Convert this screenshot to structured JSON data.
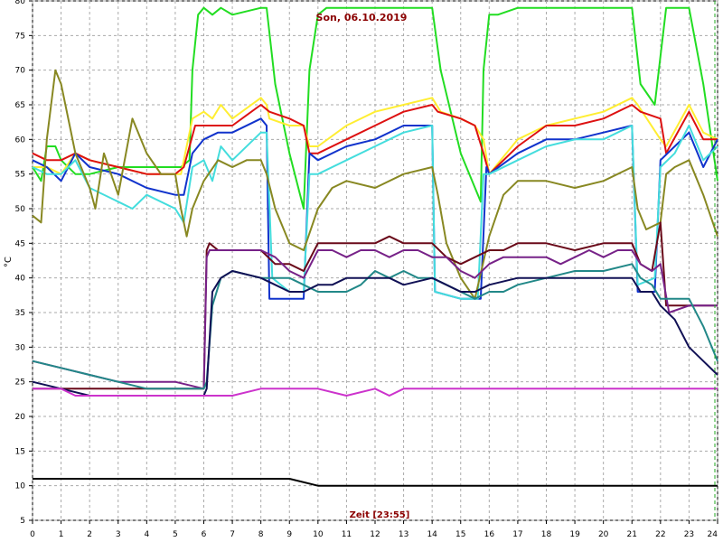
{
  "chart_data": {
    "type": "line",
    "title": "Son, 06.10.2019",
    "xlabel": "Zeit [23:55]",
    "ylabel": "°C",
    "xlim": [
      0,
      24
    ],
    "ylim": [
      5,
      80
    ],
    "xticks": [
      "0",
      "1",
      "2",
      "3",
      "4",
      "5",
      "6",
      "7",
      "8",
      "9",
      "10",
      "11",
      "12",
      "13",
      "14",
      "15",
      "16",
      "17",
      "18",
      "19",
      "20",
      "21",
      "22",
      "23",
      "24"
    ],
    "yticks": [
      "5",
      "10",
      "15",
      "20",
      "25",
      "30",
      "35",
      "40",
      "45",
      "50",
      "55",
      "60",
      "65",
      "70",
      "75",
      "80"
    ],
    "grid": true,
    "series": [
      {
        "color": "#22dd22",
        "x": [
          0,
          0.3,
          0.5,
          0.8,
          1,
          1.5,
          2,
          3,
          4,
          5.2,
          5.5,
          5.6,
          5.8,
          6,
          6.3,
          6.6,
          7,
          8,
          8.2,
          8.5,
          9,
          9.5,
          9.7,
          10,
          10.3,
          11,
          12,
          13,
          14,
          14.3,
          15,
          15.7,
          15.8,
          16,
          16.3,
          17,
          18,
          19,
          20,
          21,
          21.3,
          21.8,
          22,
          22.2,
          22.5,
          23,
          23.5,
          24
        ],
        "y": [
          56,
          54,
          59,
          59,
          57,
          55,
          55,
          56,
          56,
          56,
          57,
          70,
          78,
          79,
          78,
          79,
          78,
          79,
          79,
          68,
          58,
          50,
          70,
          78,
          79,
          79,
          79,
          79,
          79,
          70,
          58,
          51,
          70,
          78,
          78,
          79,
          79,
          79,
          79,
          79,
          68,
          65,
          72,
          79,
          79,
          79,
          68,
          54
        ]
      },
      {
        "color": "#ffee33",
        "x": [
          0,
          0.5,
          1,
          1.5,
          2,
          3,
          4,
          5,
          5.2,
          5.6,
          6,
          6.3,
          6.6,
          7,
          8,
          8.2,
          8.3,
          9,
          9.5,
          9.7,
          10,
          11,
          12,
          13,
          14,
          14.3,
          15,
          15.5,
          15.8,
          16,
          17,
          18,
          19,
          20,
          21,
          21.2,
          22,
          22.2,
          23,
          23.5,
          24
        ],
        "y": [
          56,
          56,
          55,
          58,
          57,
          56,
          55,
          55,
          55,
          63,
          64,
          63,
          65,
          63,
          66,
          65,
          63,
          62,
          62,
          59,
          59,
          62,
          64,
          65,
          66,
          64,
          63,
          62,
          60,
          55,
          60,
          62,
          63,
          64,
          66,
          65,
          60,
          59,
          65,
          61,
          60
        ]
      },
      {
        "color": "#dd1111",
        "x": [
          0,
          0.5,
          1,
          1.5,
          2,
          3,
          4,
          5,
          5.3,
          5.7,
          6,
          6.5,
          7,
          8,
          8.3,
          9,
          9.5,
          9.7,
          10,
          11,
          12,
          13,
          14,
          14.2,
          15,
          15.5,
          15.8,
          16,
          17,
          18,
          19,
          20,
          21,
          21.3,
          22,
          22.2,
          23,
          23.5,
          24
        ],
        "y": [
          58,
          57,
          57,
          58,
          57,
          56,
          55,
          55,
          56,
          62,
          62,
          62,
          62,
          65,
          64,
          63,
          62,
          58,
          58,
          60,
          62,
          64,
          65,
          64,
          63,
          62,
          58,
          55,
          59,
          62,
          62,
          63,
          65,
          64,
          63,
          58,
          64,
          60,
          60
        ]
      },
      {
        "color": "#1133cc",
        "x": [
          0,
          0.5,
          1,
          1.5,
          2,
          3,
          4,
          5,
          5.3,
          5.6,
          6,
          6.5,
          7,
          8,
          8.2,
          8.3,
          8.5,
          9,
          9.5,
          9.7,
          10,
          11,
          12,
          13,
          14,
          14.1,
          15,
          15.7,
          15.9,
          16,
          17,
          18,
          19,
          20,
          21,
          21.2,
          21.8,
          22,
          22.5,
          23,
          23.5,
          24
        ],
        "y": [
          57,
          56,
          54,
          58,
          56,
          55,
          53,
          52,
          52,
          58,
          60,
          61,
          61,
          63,
          62,
          37,
          37,
          37,
          37,
          58,
          57,
          59,
          60,
          62,
          62,
          38,
          37,
          37,
          56,
          55,
          58,
          60,
          60,
          61,
          62,
          38,
          38,
          57,
          59,
          61,
          56,
          60
        ]
      },
      {
        "color": "#44dddd",
        "x": [
          0,
          0.5,
          1,
          1.5,
          2,
          3,
          3.5,
          4,
          5,
          5.3,
          5.6,
          6,
          6.3,
          6.6,
          7,
          8,
          8.2,
          8.4,
          9,
          9.5,
          9.7,
          10,
          11,
          12,
          13,
          14,
          14.1,
          15,
          15.6,
          15.8,
          16,
          17,
          18,
          19,
          20,
          21,
          21.2,
          21.8,
          22,
          22.5,
          23,
          23.5,
          24
        ],
        "y": [
          56,
          55,
          55,
          57,
          53,
          51,
          50,
          52,
          50,
          48,
          56,
          57,
          54,
          59,
          57,
          61,
          61,
          40,
          38,
          38,
          55,
          55,
          57,
          59,
          61,
          62,
          38,
          37,
          37,
          55,
          55,
          57,
          59,
          60,
          60,
          62,
          39,
          40,
          56,
          58,
          62,
          57,
          59
        ]
      },
      {
        "color": "#888822",
        "x": [
          0,
          0.3,
          0.5,
          0.8,
          1,
          1.3,
          1.5,
          2,
          2.2,
          2.5,
          3,
          3.5,
          4,
          4.5,
          5,
          5.2,
          5.4,
          5.6,
          6,
          6.5,
          7,
          7.5,
          8,
          8.2,
          8.5,
          9,
          9.5,
          10,
          10.5,
          11,
          12,
          13,
          14,
          14.2,
          14.5,
          15,
          15.5,
          16,
          16.5,
          17,
          18,
          19,
          20,
          21,
          21.2,
          21.5,
          22,
          22.2,
          22.5,
          23,
          23.5,
          24
        ],
        "y": [
          49,
          48,
          60,
          70,
          68,
          62,
          58,
          53,
          50,
          58,
          52,
          63,
          58,
          55,
          55,
          50,
          46,
          50,
          54,
          57,
          56,
          57,
          57,
          55,
          50,
          45,
          44,
          50,
          53,
          54,
          53,
          55,
          56,
          52,
          45,
          40,
          37,
          46,
          52,
          54,
          54,
          53,
          54,
          56,
          50,
          47,
          48,
          55,
          56,
          57,
          52,
          46
        ]
      },
      {
        "color": "#6a0a1a",
        "x": [
          0,
          6,
          6.1,
          6.2,
          6.5,
          7,
          8,
          8.5,
          9,
          9.5,
          10,
          11,
          12,
          12.5,
          13,
          14,
          14.5,
          15,
          15.5,
          16,
          16.5,
          17,
          18,
          19,
          20,
          21,
          21.3,
          21.7,
          22,
          22.2,
          23,
          24
        ],
        "y": [
          24,
          24,
          44,
          45,
          44,
          44,
          44,
          42,
          42,
          41,
          45,
          45,
          45,
          46,
          45,
          45,
          43,
          42,
          43,
          44,
          44,
          45,
          45,
          44,
          45,
          45,
          42,
          41,
          48,
          36,
          36,
          36
        ]
      },
      {
        "color": "#772288",
        "x": [
          0,
          1,
          2,
          3,
          4,
          5,
          6,
          6.1,
          6.2,
          6.5,
          7,
          7.5,
          8,
          8.5,
          9,
          9.5,
          10,
          10.5,
          11,
          11.5,
          12,
          12.5,
          13,
          13.5,
          14,
          14.5,
          15,
          15.5,
          16,
          16.5,
          17,
          17.5,
          18,
          18.5,
          19,
          19.5,
          20,
          20.5,
          21,
          21.3,
          21.7,
          22,
          22.3,
          23,
          24
        ],
        "y": [
          28,
          27,
          26,
          25,
          25,
          25,
          24,
          43,
          44,
          44,
          44,
          44,
          44,
          43,
          41,
          40,
          44,
          44,
          43,
          44,
          44,
          43,
          44,
          44,
          43,
          43,
          41,
          40,
          42,
          43,
          43,
          43,
          43,
          42,
          43,
          44,
          43,
          44,
          44,
          42,
          41,
          42,
          35,
          36,
          36
        ]
      },
      {
        "color": "#228888",
        "x": [
          0,
          1,
          2,
          3,
          4,
          5,
          6,
          6.1,
          6.3,
          6.6,
          7,
          8,
          8.5,
          9,
          9.5,
          10,
          10.5,
          11,
          11.5,
          12,
          12.5,
          13,
          13.5,
          14,
          14.5,
          15,
          15.5,
          16,
          16.5,
          17,
          18,
          19,
          20,
          21,
          21.3,
          21.7,
          22,
          22.5,
          23,
          23.5,
          24
        ],
        "y": [
          28,
          27,
          26,
          25,
          24,
          24,
          24,
          25,
          36,
          40,
          41,
          40,
          40,
          40,
          39,
          38,
          38,
          38,
          39,
          41,
          40,
          41,
          40,
          40,
          39,
          38,
          37,
          38,
          38,
          39,
          40,
          41,
          41,
          42,
          40,
          39,
          37,
          37,
          37,
          33,
          28
        ]
      },
      {
        "color": "#111155",
        "x": [
          0,
          1,
          2,
          3,
          4,
          5,
          6,
          6.1,
          6.3,
          6.6,
          7,
          8,
          8.5,
          9,
          9.5,
          10,
          10.5,
          11,
          12,
          12.5,
          13,
          14,
          14.5,
          15,
          15.5,
          16,
          17,
          18,
          19,
          20,
          21,
          21.3,
          21.7,
          22,
          22.5,
          23,
          23.5,
          24
        ],
        "y": [
          25,
          24,
          23,
          23,
          23,
          23,
          23,
          24,
          38,
          40,
          41,
          40,
          39,
          38,
          38,
          39,
          39,
          40,
          40,
          40,
          39,
          40,
          39,
          38,
          38,
          39,
          40,
          40,
          40,
          40,
          40,
          38,
          38,
          36,
          34,
          30,
          28,
          26
        ]
      },
      {
        "color": "#cc33cc",
        "x": [
          0,
          1,
          1.5,
          2,
          3,
          4,
          5,
          6,
          7,
          8,
          9,
          10,
          11,
          12,
          12.5,
          13,
          14,
          15,
          16,
          17,
          18,
          19,
          20,
          21,
          22,
          23,
          24
        ],
        "y": [
          24,
          24,
          23,
          23,
          23,
          23,
          23,
          23,
          23,
          24,
          24,
          24,
          23,
          24,
          23,
          24,
          24,
          24,
          24,
          24,
          24,
          24,
          24,
          24,
          24,
          24,
          24
        ]
      },
      {
        "color": "#000000",
        "x": [
          0,
          1,
          2,
          3,
          4,
          5,
          6,
          7,
          8,
          9,
          10,
          11,
          12,
          13,
          14,
          15,
          16,
          17,
          18,
          19,
          20,
          21,
          22,
          23,
          24
        ],
        "y": [
          11,
          11,
          11,
          11,
          11,
          11,
          11,
          11,
          11,
          11,
          10,
          10,
          10,
          10,
          10,
          10,
          10,
          10,
          10,
          10,
          10,
          10,
          10,
          10,
          10
        ]
      }
    ]
  }
}
